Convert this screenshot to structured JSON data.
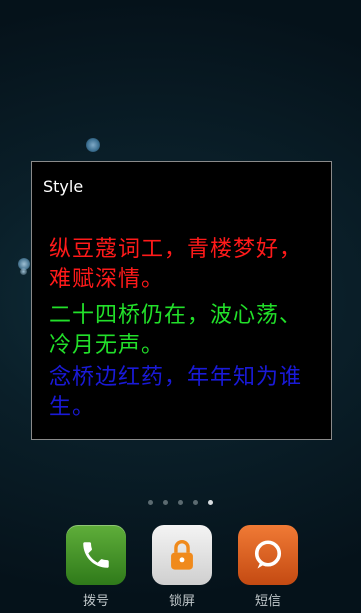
{
  "dialog": {
    "title": "Style",
    "lines": [
      {
        "text": "纵豆蔻词工，青楼梦好，难赋深情。",
        "color": "#ff1a1a"
      },
      {
        "text": "二十四桥仍在，波心荡、冷月无声。",
        "color": "#22e02a"
      },
      {
        "text": "念桥边红药，年年知为谁生。",
        "color": "#1a1ad8"
      }
    ]
  },
  "pager": {
    "count": 5,
    "active": 4
  },
  "dock": [
    {
      "label": "拨号",
      "icon": "phone-icon"
    },
    {
      "label": "锁屏",
      "icon": "lock-icon"
    },
    {
      "label": "短信",
      "icon": "message-icon"
    }
  ]
}
